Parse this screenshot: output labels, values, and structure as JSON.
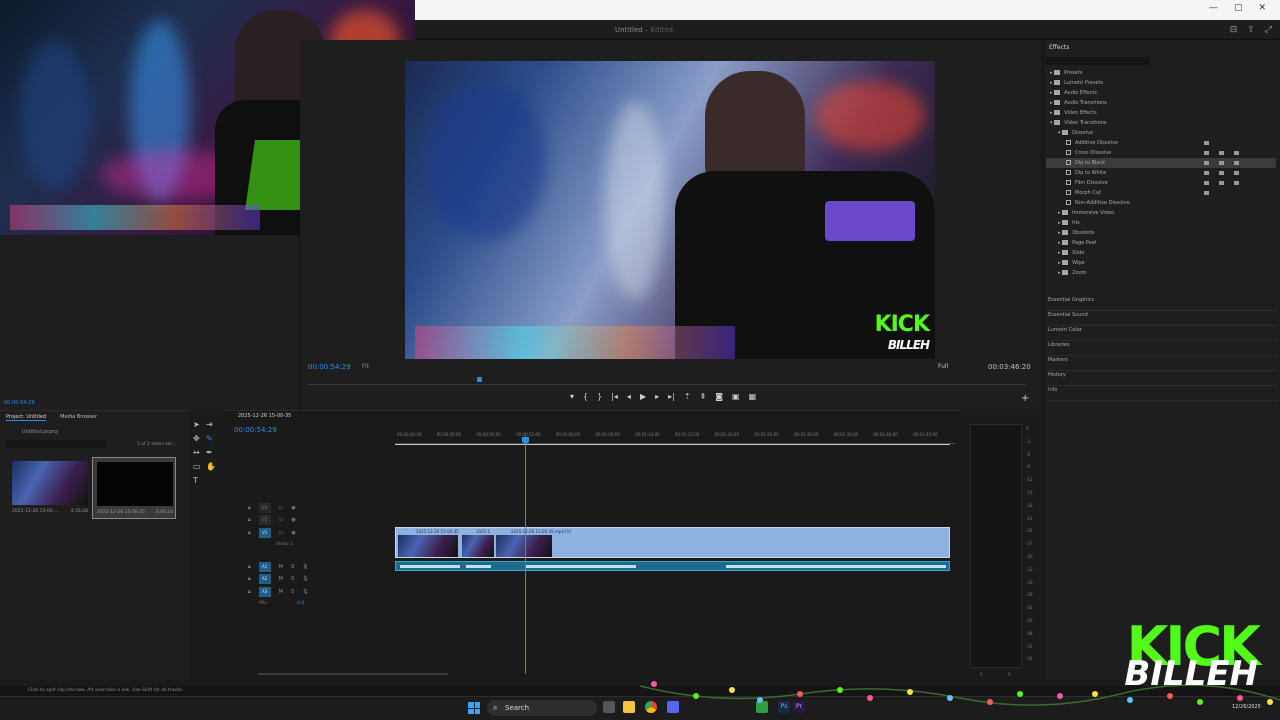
{
  "window": {
    "document_title": "Untitled",
    "document_status": "Edited",
    "controls": [
      "—",
      "▢",
      "✕"
    ]
  },
  "source_monitor": {
    "timecode": "00:00:54:29"
  },
  "program_monitor": {
    "timecode": "00:00:54:29",
    "zoom": "Fit",
    "resolution": "Full",
    "duration": "00:03:46:20",
    "overlay_logo_top": "KICK",
    "overlay_logo_bottom": "BILLEH"
  },
  "effects": {
    "title": "Effects",
    "tree": [
      {
        "label": "Presets",
        "level": 1,
        "type": "folder"
      },
      {
        "label": "Lumetri Presets",
        "level": 1,
        "type": "folder"
      },
      {
        "label": "Audio Effects",
        "level": 1,
        "type": "folder"
      },
      {
        "label": "Audio Transitions",
        "level": 1,
        "type": "folder"
      },
      {
        "label": "Video Effects",
        "level": 1,
        "type": "folder"
      },
      {
        "label": "Video Transitions",
        "level": 1,
        "type": "folder"
      },
      {
        "label": "Dissolve",
        "level": 2,
        "type": "folder"
      },
      {
        "label": "Additive Dissolve",
        "level": 3,
        "type": "fx",
        "badges": 1
      },
      {
        "label": "Cross Dissolve",
        "level": 3,
        "type": "fx",
        "badges": 3
      },
      {
        "label": "Dip to Black",
        "level": 3,
        "type": "fx",
        "badges": 3,
        "selected": true
      },
      {
        "label": "Dip to White",
        "level": 3,
        "type": "fx",
        "badges": 3
      },
      {
        "label": "Film Dissolve",
        "level": 3,
        "type": "fx",
        "badges": 3
      },
      {
        "label": "Morph Cut",
        "level": 3,
        "type": "fx",
        "badges": 1
      },
      {
        "label": "Non-Additive Dissolve",
        "level": 3,
        "type": "fx",
        "badges": 0
      },
      {
        "label": "Immersive Video",
        "level": 2,
        "type": "folder"
      },
      {
        "label": "Iris",
        "level": 2,
        "type": "folder"
      },
      {
        "label": "Obsolete",
        "level": 2,
        "type": "folder"
      },
      {
        "label": "Page Peel",
        "level": 2,
        "type": "folder"
      },
      {
        "label": "Slide",
        "level": 2,
        "type": "folder"
      },
      {
        "label": "Wipe",
        "level": 2,
        "type": "folder"
      },
      {
        "label": "Zoom",
        "level": 2,
        "type": "folder"
      }
    ],
    "panels": [
      "Essential Graphics",
      "Essential Sound",
      "Lumetri Color",
      "Libraries",
      "Markers",
      "History",
      "Info"
    ]
  },
  "project": {
    "tabs": [
      "Project: Untitled",
      "Media Browser"
    ],
    "file": "Untitled.prproj",
    "count": "1 of 2 items sel...",
    "items": [
      {
        "name": "2025-12-26 15-00-...",
        "duration": "4:35:28"
      },
      {
        "name": "2025-12-26 15-00-35",
        "duration": "3:46:20"
      }
    ]
  },
  "timeline": {
    "sequence_name": "2025-12-26 15-00-35",
    "timecode": "00:00:54:29",
    "ruler": [
      "00:00:40:00",
      "00:00:45:00",
      "00:00:50:00",
      "00:00:55:00",
      "00:01:00:00",
      "00:01:05:00",
      "00:01:10:00",
      "00:01:15:00",
      "00:01:20:00",
      "00:01:25:00",
      "00:01:30:00",
      "00:01:35:00",
      "00:01:40:00",
      "00:01:45:00"
    ],
    "video_tracks": [
      "V3",
      "V2",
      "V1"
    ],
    "v1_name": "Video 1",
    "audio_tracks": [
      "A1",
      "A2",
      "A3"
    ],
    "audio_buttons": [
      "M",
      "S"
    ],
    "mix_label": "Mix",
    "mix_value": "0.0",
    "clip_labels": [
      "2025-12-26 15-00-35",
      "2025-1",
      "2025-12-26 15-00-35.mp4 [V]"
    ]
  },
  "meter": {
    "db_scale": [
      "0",
      "-3",
      "-6",
      "-9",
      "-12",
      "-15",
      "-18",
      "-21",
      "-24",
      "-27",
      "-30",
      "-33",
      "-36",
      "-39",
      "-42",
      "-45",
      "-48",
      "-51",
      "-54"
    ],
    "channels": [
      "S",
      "S"
    ]
  },
  "status_bar": {
    "text": "Click to split clip into two. Alt overrides a link. Use Shift for all tracks."
  },
  "taskbar": {
    "search_placeholder": "Search",
    "date": "12/26/2025"
  },
  "branding": {
    "kick": "KICK",
    "billeh": "BILLEH",
    "kick_color": "#53fc18"
  },
  "colors": {
    "accent": "#2d8ceb",
    "video_clip": "#8fb3e0",
    "audio_clip": "#1c6b8e"
  }
}
